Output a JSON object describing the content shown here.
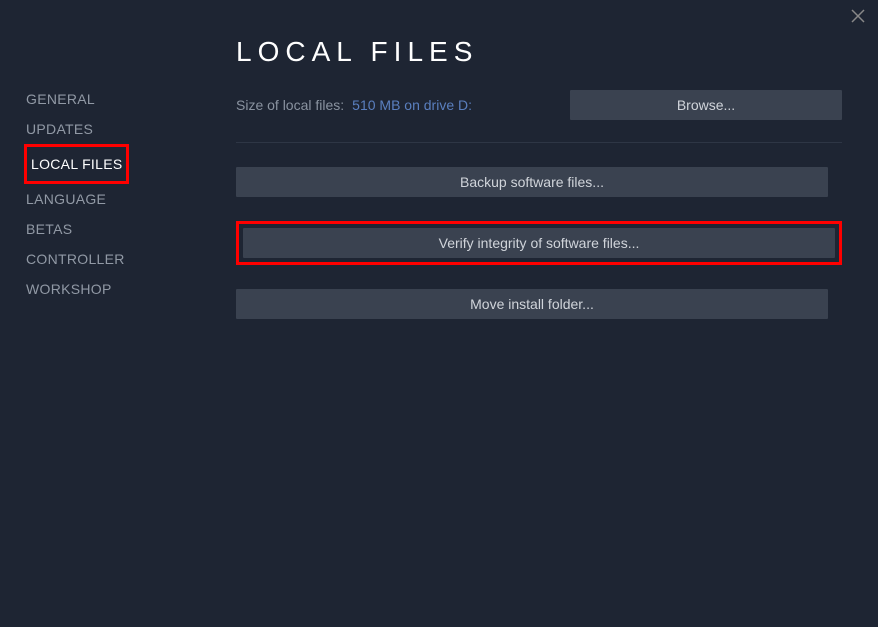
{
  "sidebar": {
    "items": [
      {
        "label": "GENERAL",
        "active": false,
        "highlight": false
      },
      {
        "label": "UPDATES",
        "active": false,
        "highlight": false
      },
      {
        "label": "LOCAL FILES",
        "active": true,
        "highlight": true
      },
      {
        "label": "LANGUAGE",
        "active": false,
        "highlight": false
      },
      {
        "label": "BETAS",
        "active": false,
        "highlight": false
      },
      {
        "label": "CONTROLLER",
        "active": false,
        "highlight": false
      },
      {
        "label": "WORKSHOP",
        "active": false,
        "highlight": false
      }
    ]
  },
  "main": {
    "title": "LOCAL FILES",
    "size_label": "Size of local files:",
    "size_value": "510 MB on drive D:",
    "browse_label": "Browse...",
    "actions": [
      {
        "label": "Backup software files...",
        "highlight": false
      },
      {
        "label": "Verify integrity of software files...",
        "highlight": true
      },
      {
        "label": "Move install folder...",
        "highlight": false
      }
    ]
  }
}
